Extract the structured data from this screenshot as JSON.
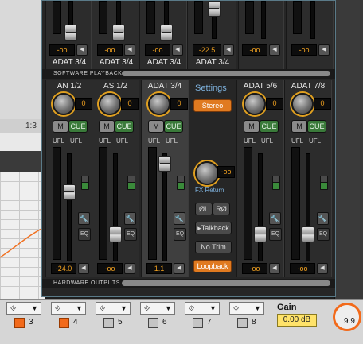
{
  "host": {
    "ruler_label": "1:3",
    "gain": {
      "label": "Gain",
      "value": "0.00 dB"
    },
    "right_value": "9.9",
    "channels": [
      {
        "number": "3",
        "active": true
      },
      {
        "number": "4",
        "active": true
      },
      {
        "number": "5",
        "active": false
      },
      {
        "number": "6",
        "active": false
      },
      {
        "number": "7",
        "active": false
      },
      {
        "number": "8",
        "active": false
      }
    ],
    "colors": {
      "active": "#f26a1b",
      "inactive": "#c4c4c4",
      "gain_field": "#ffe36a"
    }
  },
  "top_row": {
    "values": [
      "-oo",
      "-oo",
      "-oo",
      "-22.5",
      "-oo",
      "-oo"
    ],
    "names": [
      "ADAT 3/4",
      "ADAT 3/4",
      "ADAT 3/4",
      "ADAT 3/4"
    ]
  },
  "sections": {
    "software_playback": "SOFTWARE PLAYBACK",
    "hardware_outputs": "HARDWARE OUTPUTS"
  },
  "strips": [
    {
      "name": "AN 1/2",
      "knob": "0",
      "mute": "M",
      "cue": "CUE",
      "ufl": [
        "UFL",
        "UFL"
      ],
      "value": "-24.0",
      "fader_level": 0.55,
      "eq": "EQ"
    },
    {
      "name": "AS 1/2",
      "knob": "0",
      "mute": "M",
      "cue": "CUE",
      "ufl": [
        "UFL",
        "UFL"
      ],
      "value": "-oo",
      "fader_level": 0.1,
      "eq": "EQ"
    },
    {
      "name": "ADAT 3/4",
      "knob": "0",
      "mute": "M",
      "cue": "CUE",
      "ufl": [
        "UFL",
        "UFL"
      ],
      "value": "1.1",
      "fader_level": 0.86,
      "eq": "EQ",
      "selected": true
    },
    {
      "name": "ADAT 5/6",
      "knob": "0",
      "mute": "M",
      "cue": "CUE",
      "ufl": [
        "UFL",
        "UFL"
      ],
      "value": "-oo",
      "fader_level": 0.1,
      "eq": "EQ"
    },
    {
      "name": "ADAT 7/8",
      "knob": "0",
      "mute": "M",
      "cue": "CUE",
      "ufl": [
        "UFL",
        "UFL"
      ],
      "value": "-oo",
      "fader_level": 0.1,
      "eq": "EQ"
    }
  ],
  "settings": {
    "title": "Settings",
    "stereo": "Stereo",
    "fx_value": "-oo",
    "fx_return": "FX Return",
    "phase_l": "ØL",
    "phase_r": "RØ",
    "talkback": "Talkback",
    "no_trim": "No Trim",
    "loopback": "Loopback"
  }
}
